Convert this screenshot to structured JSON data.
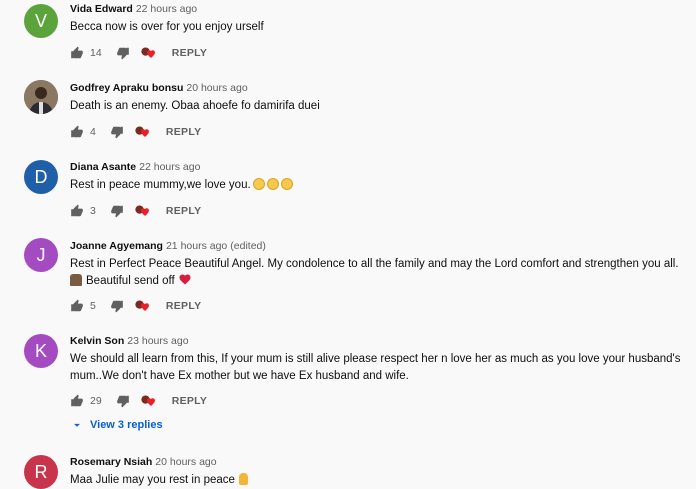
{
  "colors": {
    "reply_link": "#065fd4",
    "meta": "#606060"
  },
  "comments": [
    {
      "avatar_letter": "V",
      "avatar_color": "#5aa43b",
      "author": "Vida Edward",
      "time": "22 hours ago",
      "edited": "",
      "text": "Becca  now  is  over  for  you  enjoy  urself",
      "likes": "14",
      "reply": "REPLY"
    },
    {
      "avatar_letter": "",
      "avatar_color": "#6b5a48",
      "author": "Godfrey Apraku bonsu",
      "time": "20 hours ago",
      "edited": "",
      "text": "Death is an enemy. Obaa ahoefe  fo damirifa duei",
      "likes": "4",
      "reply": "REPLY"
    },
    {
      "avatar_letter": "D",
      "avatar_color": "#1f5fa8",
      "author": "Diana Asante",
      "time": "22 hours ago",
      "edited": "",
      "text": "Rest in peace mummy,we love you.",
      "likes": "3",
      "reply": "REPLY"
    },
    {
      "avatar_letter": "J",
      "avatar_color": "#a44bc2",
      "author": "Joanne Agyemang",
      "time": "21 hours ago",
      "edited": "(edited)",
      "text": "Rest in Perfect Peace Beautiful Angel. My condolence to all the family and may the Lord comfort and strengthen you all.",
      "text2": "Beautiful send off",
      "likes": "5",
      "reply": "REPLY"
    },
    {
      "avatar_letter": "K",
      "avatar_color": "#a44bc2",
      "author": "Kelvin Son",
      "time": "23 hours ago",
      "edited": "",
      "text": "We should all learn from this, If your mum is still alive please respect her n love her as much as you love your husband's mum..We don't have Ex mother but we have Ex husband and wife.",
      "likes": "29",
      "reply": "REPLY",
      "view_replies": "View 3 replies"
    },
    {
      "avatar_letter": "R",
      "avatar_color": "#c9344d",
      "author": "Rosemary Nsiah",
      "time": "20 hours ago",
      "edited": "",
      "text": "Maa Julie may you rest in peace"
    }
  ],
  "icons": {
    "like": "thumbs-up-icon",
    "dislike": "thumbs-down-icon",
    "heart": "creator-heart-icon",
    "chevron": "chevron-down-icon"
  }
}
